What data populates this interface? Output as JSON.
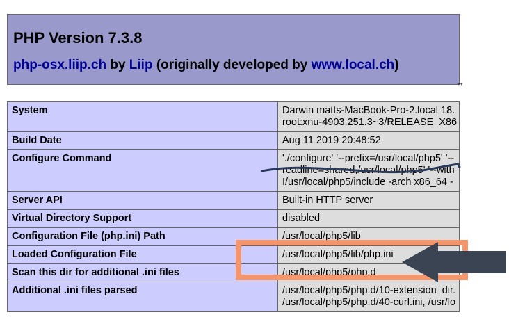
{
  "header": {
    "title": "PHP Version 7.3.8",
    "line_parts": {
      "link1": "php-osx.liip.ch",
      "by": " by ",
      "link2": "Liip",
      "middle": " (originally developed by ",
      "link3": "www.local.ch",
      "end": ")"
    }
  },
  "rows": [
    {
      "label": "System",
      "value": [
        "Darwin matts-MacBook-Pro-2.local 18.",
        "root:xnu-4903.251.3~3/RELEASE_X86"
      ]
    },
    {
      "label": "Build Date",
      "value": [
        "Aug 11 2019 20:48:52"
      ]
    },
    {
      "label": "Configure Command",
      "value": [
        "'./configure' '--prefix=/usr/local/php5' '--",
        "readline=shared,/usr/local/php5' '--with",
        "I/usr/local/php5/include -arch x86_64 -"
      ]
    },
    {
      "label": "Server API",
      "value": [
        "Built-in HTTP server"
      ]
    },
    {
      "label": "Virtual Directory Support",
      "value": [
        "disabled"
      ]
    },
    {
      "label": "Configuration File (php.ini) Path",
      "value": [
        "/usr/local/php5/lib"
      ]
    },
    {
      "label": "Loaded Configuration File",
      "value": [
        "/usr/local/php5/lib/php.ini"
      ]
    },
    {
      "label": "Scan this dir for additional .ini files",
      "value": [
        "/usr/local/php5/php.d"
      ]
    },
    {
      "label": "Additional .ini files parsed",
      "value": [
        "/usr/local/php5/php.d/10-extension_dir.",
        "/usr/local/php5/php.d/40-curl.ini, /usr/lo"
      ]
    }
  ],
  "annotation": {
    "highlight_color": "#f5956b",
    "arrow_color": "#3b4453",
    "scribble_color": "#2a3a5a"
  }
}
